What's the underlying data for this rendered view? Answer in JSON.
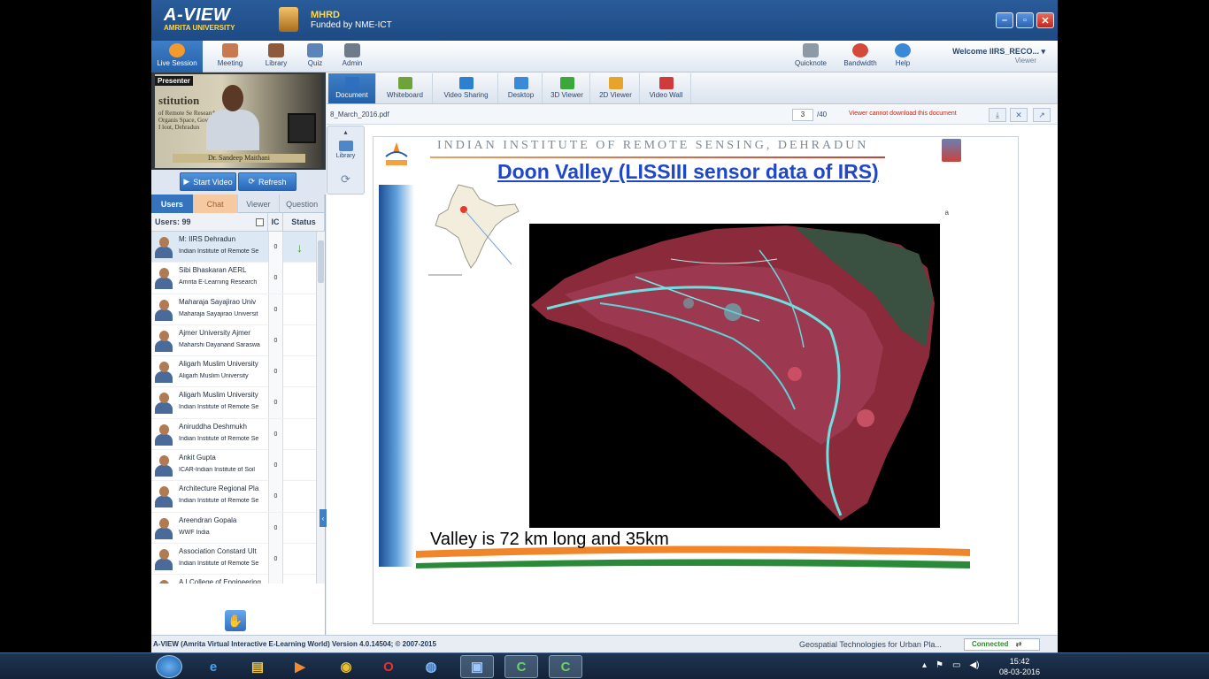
{
  "app": {
    "name": "A-VIEW",
    "university": "AMRITA UNIVERSITY",
    "mhrd": "MHRD",
    "funded": "Funded by NME-ICT"
  },
  "window_controls": {
    "minimize": "–",
    "restore": "▫",
    "close": "✕"
  },
  "topmenu": {
    "items": [
      {
        "label": "Live Session",
        "icon": "live-session-icon"
      },
      {
        "label": "Meeting",
        "icon": "meeting-icon"
      },
      {
        "label": "Library",
        "icon": "library-icon"
      },
      {
        "label": "Quiz",
        "icon": "quiz-icon"
      },
      {
        "label": "Admin",
        "icon": "admin-icon"
      }
    ],
    "right_items": [
      {
        "label": "Quicknote",
        "icon": "quicknote-icon"
      },
      {
        "label": "Bandwidth",
        "icon": "bandwidth-icon"
      },
      {
        "label": "Help",
        "icon": "help-icon"
      }
    ],
    "welcome": "Welcome IIRS_RECO...",
    "role": "Viewer"
  },
  "presenter": {
    "label": "Presenter",
    "bg_text": "stitution",
    "bg_text2": "of Remote Se Research Organis Space, Govt. of I lout, Dehradun",
    "nameplate": "Dr. Sandeep Maithani",
    "start_video": "Start Video",
    "refresh": "Refresh"
  },
  "left_tabs": [
    "Users",
    "Chat",
    "Viewer",
    "Question"
  ],
  "users_header": {
    "count": "Users: 99",
    "ic": "IC",
    "status": "Status"
  },
  "users": [
    {
      "name": "M: IIRS Dehradun",
      "org": "Indian Institute of Remote Se",
      "ic": "0",
      "status": "↓"
    },
    {
      "name": "Sibi Bhaskaran AERL",
      "org": "Amrita E-Learning Research",
      "ic": "0",
      "status": ""
    },
    {
      "name": " Maharaja Sayajirao Univ",
      "org": "Maharaja Sayajirao Universit",
      "ic": "0",
      "status": ""
    },
    {
      "name": "Ajmer University Ajmer",
      "org": "Maharshi Dayanand Saraswa",
      "ic": "0",
      "status": ""
    },
    {
      "name": "Aligarh Muslim University",
      "org": "Aligarh Muslim University",
      "ic": "0",
      "status": ""
    },
    {
      "name": "Aligarh Muslim University",
      "org": "Indian Institute of Remote Se",
      "ic": "0",
      "status": ""
    },
    {
      "name": "Aniruddha Deshmukh",
      "org": "Indian Institute of Remote Se",
      "ic": "0",
      "status": ""
    },
    {
      "name": "Ankit Gupta",
      "org": "ICAR-Indian Institute of Soil",
      "ic": "0",
      "status": ""
    },
    {
      "name": "Architecture  Regional Pla",
      "org": "Indian Institute of Remote Se",
      "ic": "0",
      "status": ""
    },
    {
      "name": "Areendran Gopala",
      "org": "WWF India",
      "ic": "0",
      "status": ""
    },
    {
      "name": "Association Constard Ult",
      "org": "Indian Institute of Remote Se",
      "ic": "0",
      "status": ""
    },
    {
      "name": "A.I.College of Engineering",
      "org": "",
      "ic": "",
      "status": ""
    }
  ],
  "subtabs": [
    {
      "label": "Document",
      "icon": "document-icon",
      "color": "#2f6fc0"
    },
    {
      "label": "Whiteboard",
      "icon": "whiteboard-icon",
      "color": "#6ea33a"
    },
    {
      "label": "Video Sharing",
      "icon": "video-sharing-icon",
      "color": "#2f7fd0"
    },
    {
      "label": "Desktop",
      "icon": "desktop-icon",
      "color": "#3a8ad8"
    },
    {
      "label": "3D Viewer",
      "icon": "3d-viewer-icon",
      "color": "#3aa83a"
    },
    {
      "label": "2D Viewer",
      "icon": "2d-viewer-icon",
      "color": "#e6a52a"
    },
    {
      "label": "Video Wall",
      "icon": "video-wall-icon",
      "color": "#d03a3a"
    }
  ],
  "docbar": {
    "filename": "8_March_2016.pdf",
    "page": "3",
    "total": "/40",
    "warning": "Viewer cannot download this document"
  },
  "sidetools": {
    "library": "Library"
  },
  "slide": {
    "institute": "INDIAN INSTITUTE OF REMOTE SENSING, DEHRADUN",
    "title": "Doon Valley (LISSIII sensor data of IRS)",
    "caption": "Valley is 72 km long and 35km",
    "stray": "ᵃ"
  },
  "statusbar": {
    "version": "A-VIEW (Amrita Virtual Interactive E-Learning World) Version 4.0.14504; © 2007-2015",
    "course": "Geospatial Technologies for Urban Pla...",
    "connection": "Connected"
  },
  "taskbar": {
    "time": "15:42",
    "date": "08-03-2016"
  }
}
